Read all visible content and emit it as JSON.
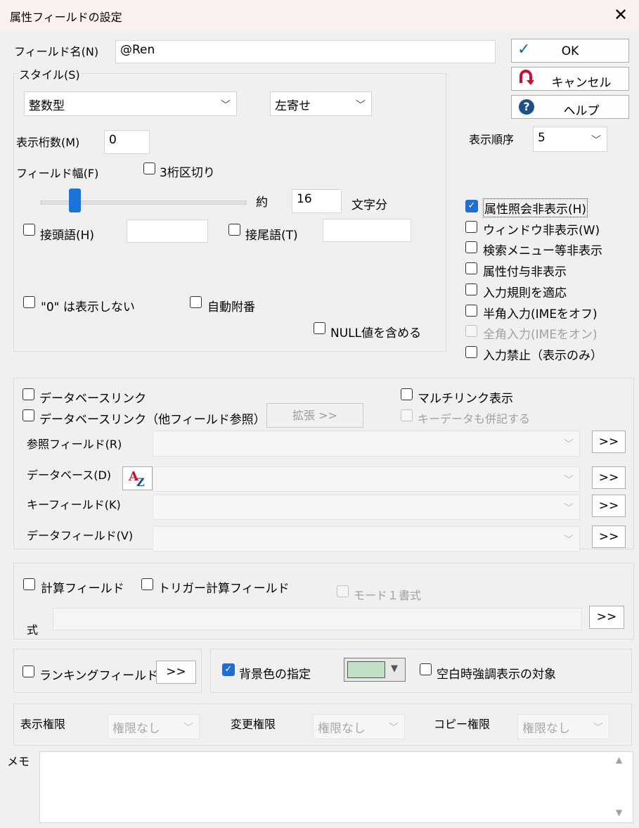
{
  "window": {
    "title": "属性フィールドの設定"
  },
  "field_name": {
    "label": "フィールド名(N)",
    "value": "@Ren"
  },
  "buttons": {
    "ok": "OK",
    "cancel": "キャンセル",
    "help": "ヘルプ"
  },
  "style": {
    "group_label": "スタイル(S)",
    "type_value": "整数型",
    "align_value": "左寄せ",
    "digits_label": "表示桁数(M)",
    "digits_value": "0",
    "width_label": "フィールド幅(F)",
    "thousands_sep": "3桁区切り",
    "approx_label": "約",
    "char_width_value": "16",
    "char_unit": "文字分",
    "slider_level_fraction": 0.17,
    "prefix_label": "接頭語(H)",
    "suffix_label": "接尾語(T)",
    "hide_zero": "\"0\" は表示しない",
    "auto_number": "自動附番",
    "include_null": "NULL値を含める"
  },
  "display_order": {
    "label": "表示順序",
    "value": "5"
  },
  "options": [
    {
      "label": "属性照会非表示(H)",
      "checked": true,
      "enabled": true
    },
    {
      "label": "ウィンドウ非表示(W)",
      "checked": false,
      "enabled": true
    },
    {
      "label": "検索メニュー等非表示",
      "checked": false,
      "enabled": true
    },
    {
      "label": "属性付与非表示",
      "checked": false,
      "enabled": true
    },
    {
      "label": "入力規則を適応",
      "checked": false,
      "enabled": true
    },
    {
      "label": "半角入力(IMEをオフ)",
      "checked": false,
      "enabled": true
    },
    {
      "label": "全角入力(IMEをオン)",
      "checked": false,
      "enabled": false
    },
    {
      "label": "入力禁止（表示のみ）",
      "checked": false,
      "enabled": true
    }
  ],
  "db_link": {
    "db_link": "データベースリンク",
    "db_link_other": "データベースリンク（他フィールド参照）",
    "expand_button": "拡張 >>",
    "multi_link": "マルチリンク表示",
    "key_data": "キーデータも併記する",
    "ref_field_label": "参照フィールド(R)",
    "database_label": "データベース(D)",
    "key_field_label": "キーフィールド(K)",
    "data_field_label": "データフィールド(V)",
    "more_button": ">>"
  },
  "calc": {
    "calc_field": "計算フィールド",
    "trigger_calc_field": "トリガー計算フィールド",
    "mode1": "モード１書式",
    "formula_label": "式",
    "more_button": ">>"
  },
  "ranking": {
    "label": "ランキングフィールド",
    "more_button": ">>"
  },
  "background": {
    "label": "背景色の指定",
    "color": "#c2e0c6",
    "blank_emphasis": "空白時強調表示の対象"
  },
  "permissions": {
    "view_label": "表示権限",
    "view_value": "権限なし",
    "edit_label": "変更権限",
    "edit_value": "権限なし",
    "copy_label": "コピー権限",
    "copy_value": "権限なし"
  },
  "memo": {
    "label": "メモ",
    "value": ""
  },
  "colors": {
    "accent": "#1f6ed4",
    "titlebar": "#fbf1f1",
    "dialog_bg": "#f0f0f0"
  }
}
